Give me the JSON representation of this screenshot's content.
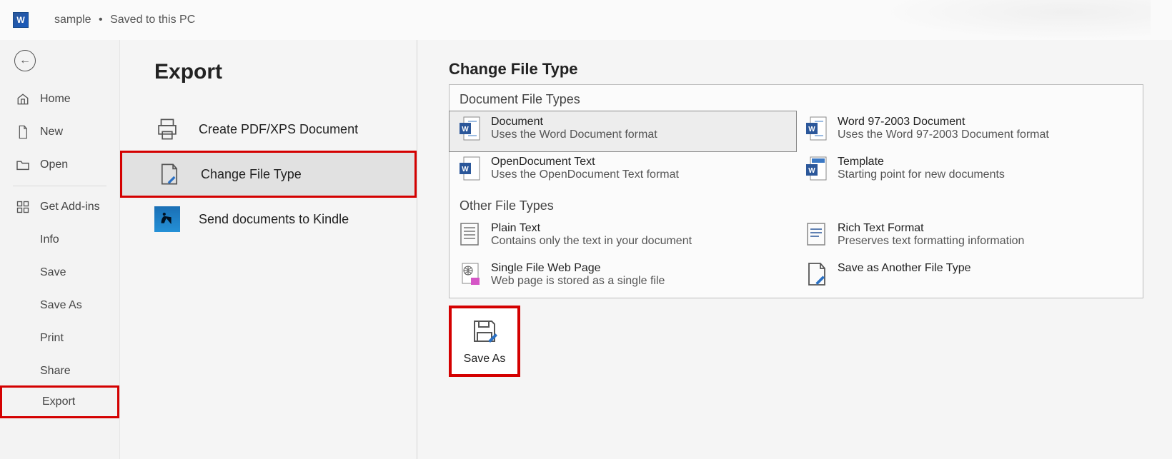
{
  "titlebar": {
    "doc_name": "sample",
    "separator": "•",
    "status": "Saved to this PC"
  },
  "sidebar": {
    "items": {
      "home": "Home",
      "new": "New",
      "open": "Open",
      "addins": "Get Add-ins",
      "info": "Info",
      "save": "Save",
      "saveas": "Save As",
      "print": "Print",
      "share": "Share",
      "export": "Export"
    }
  },
  "export": {
    "title": "Export",
    "items": {
      "pdf": "Create PDF/XPS Document",
      "cft": "Change File Type",
      "kindle": "Send documents to Kindle"
    }
  },
  "right": {
    "heading": "Change File Type",
    "doc_types_head": "Document File Types",
    "other_types_head": "Other File Types",
    "doc_types": {
      "a": {
        "title": "Document",
        "desc": "Uses the Word Document format"
      },
      "b": {
        "title": "Word 97-2003 Document",
        "desc": "Uses the Word 97-2003 Document format"
      },
      "c": {
        "title": "OpenDocument Text",
        "desc": "Uses the OpenDocument Text format"
      },
      "d": {
        "title": "Template",
        "desc": "Starting point for new documents"
      }
    },
    "other_types": {
      "a": {
        "title": "Plain Text",
        "desc": "Contains only the text in your document"
      },
      "b": {
        "title": "Rich Text Format",
        "desc": "Preserves text formatting information"
      },
      "c": {
        "title": "Single File Web Page",
        "desc": "Web page is stored as a single file"
      },
      "d": {
        "title": "Save as Another File Type",
        "desc": ""
      }
    },
    "save_as": "Save As"
  }
}
